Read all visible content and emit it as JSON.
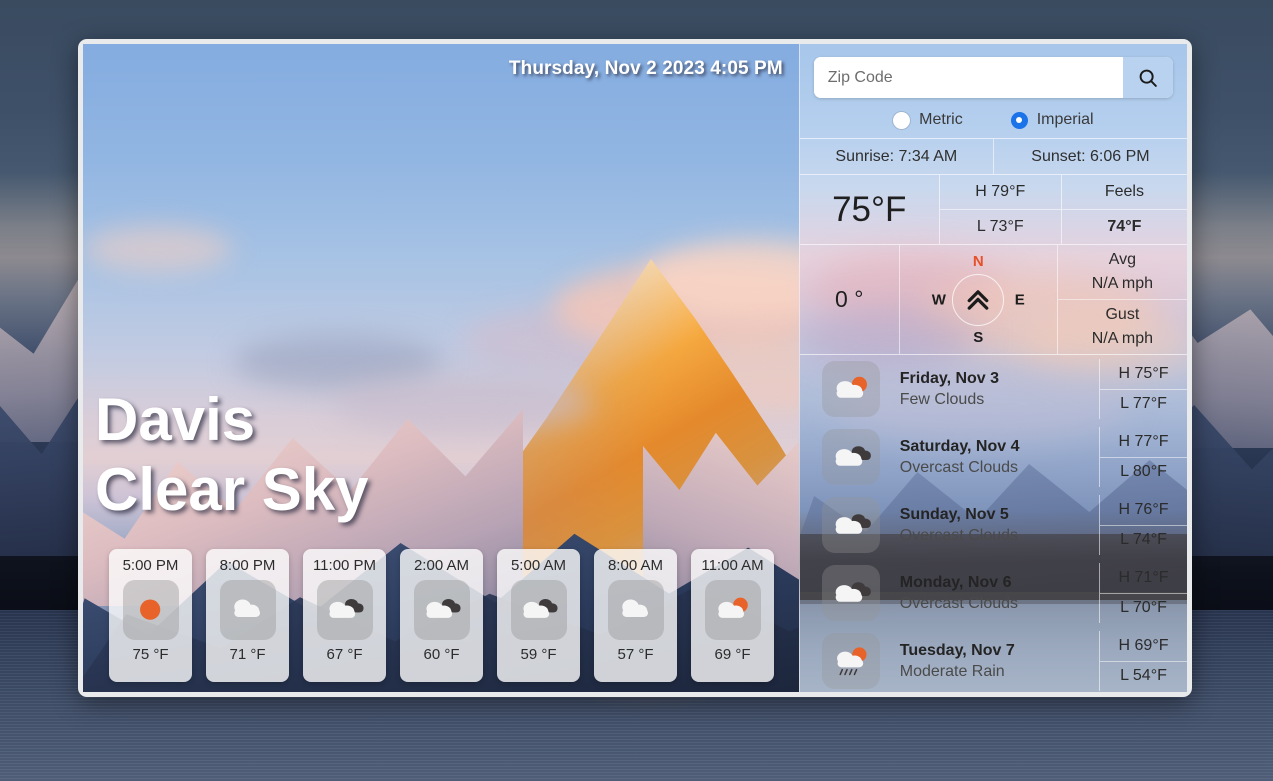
{
  "header": {
    "datetime": "Thursday, Nov 2 2023 4:05 PM"
  },
  "hero": {
    "city": "Davis",
    "condition": "Clear Sky"
  },
  "search": {
    "placeholder": "Zip Code",
    "value": "",
    "icon": "search-icon"
  },
  "units": {
    "metric_label": "Metric",
    "imperial_label": "Imperial",
    "selected": "Imperial"
  },
  "sun": {
    "sunrise": "Sunrise: 7:34 AM",
    "sunset": "Sunset: 6:06 PM"
  },
  "current": {
    "temp": "75°F",
    "high": "H 79°F",
    "low": "L 73°F",
    "feels_label": "Feels",
    "feels_value": "74°F"
  },
  "wind": {
    "degrees": "0 °",
    "compass_n": "N",
    "compass_e": "E",
    "compass_s": "S",
    "compass_w": "W",
    "arrow_icon": "double-chevron-up-icon",
    "avg_label": "Avg",
    "avg_value": "N/A mph",
    "gust_label": "Gust",
    "gust_value": "N/A mph"
  },
  "hourly": [
    {
      "time": "5:00 PM",
      "icon": "sun-icon",
      "temp": "75 °F"
    },
    {
      "time": "8:00 PM",
      "icon": "cloud-icon",
      "temp": "71 °F"
    },
    {
      "time": "11:00 PM",
      "icon": "overcast-icon",
      "temp": "67 °F"
    },
    {
      "time": "2:00 AM",
      "icon": "overcast-icon",
      "temp": "60 °F"
    },
    {
      "time": "5:00 AM",
      "icon": "overcast-icon",
      "temp": "59 °F"
    },
    {
      "time": "8:00 AM",
      "icon": "cloud-icon",
      "temp": "57 °F"
    },
    {
      "time": "11:00 AM",
      "icon": "sun-behind-cloud-icon",
      "temp": "69 °F"
    }
  ],
  "forecast": [
    {
      "day": "Friday, Nov 3",
      "desc": "Few Clouds",
      "icon": "sun-behind-cloud-icon",
      "high": "H 75°F",
      "low": "L 77°F"
    },
    {
      "day": "Saturday, Nov 4",
      "desc": "Overcast Clouds",
      "icon": "overcast-icon",
      "high": "H 77°F",
      "low": "L 80°F"
    },
    {
      "day": "Sunday, Nov 5",
      "desc": "Overcast Clouds",
      "icon": "overcast-icon",
      "high": "H 76°F",
      "low": "L 74°F"
    },
    {
      "day": "Monday, Nov 6",
      "desc": "Overcast Clouds",
      "icon": "overcast-icon",
      "high": "H 71°F",
      "low": "L 70°F"
    },
    {
      "day": "Tuesday, Nov 7",
      "desc": "Moderate Rain",
      "icon": "rain-sun-icon",
      "high": "H 69°F",
      "low": "L 54°F"
    }
  ],
  "colors": {
    "accent_blue": "#1a73e8",
    "sun_orange": "#e8632a",
    "north_red": "#e8502a",
    "cloud_white": "#f5f5f5",
    "cloud_dark": "#3f3a3c"
  }
}
